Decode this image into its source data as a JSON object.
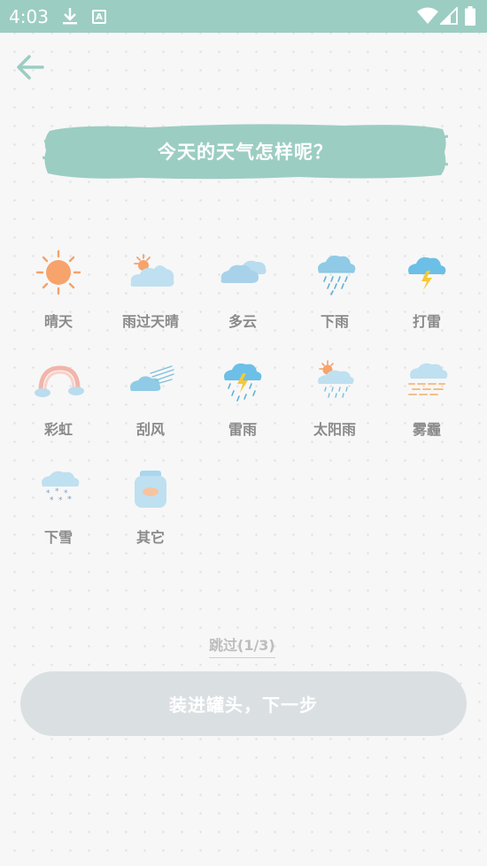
{
  "status_bar": {
    "time": "4:03",
    "a_badge": "A"
  },
  "header": {
    "title": "今天的天气怎样呢？"
  },
  "weather_options": [
    {
      "label": "晴天",
      "icon": "sun-icon"
    },
    {
      "label": "雨过天晴",
      "icon": "sun-after-rain-icon"
    },
    {
      "label": "多云",
      "icon": "cloudy-icon"
    },
    {
      "label": "下雨",
      "icon": "rain-icon"
    },
    {
      "label": "打雷",
      "icon": "thunder-icon"
    },
    {
      "label": "彩虹",
      "icon": "rainbow-icon"
    },
    {
      "label": "刮风",
      "icon": "wind-icon"
    },
    {
      "label": "雷雨",
      "icon": "thunderstorm-icon"
    },
    {
      "label": "太阳雨",
      "icon": "sun-shower-icon"
    },
    {
      "label": "雾霾",
      "icon": "haze-icon"
    },
    {
      "label": "下雪",
      "icon": "snow-icon"
    },
    {
      "label": "其它",
      "icon": "jar-icon"
    }
  ],
  "footer": {
    "skip_label": "跳过(1/3)",
    "next_label": "装进罐头，下一步"
  },
  "colors": {
    "accent": "#9ccdc2",
    "label": "#8a8a8a",
    "button_bg": "#dadfe2"
  }
}
